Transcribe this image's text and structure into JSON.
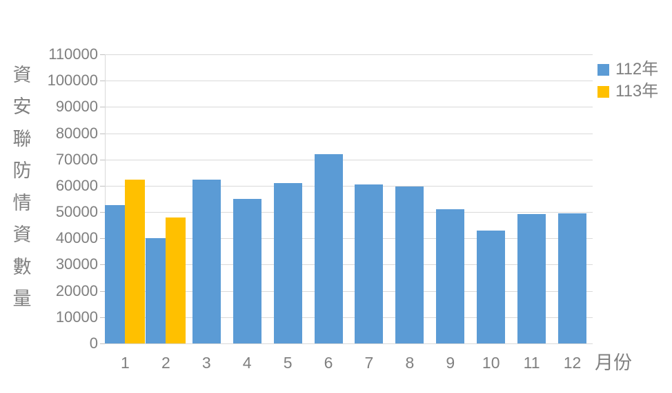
{
  "chart_data": {
    "type": "bar",
    "title": "",
    "subtitle": "",
    "xlabel": "月份",
    "ylabel": "資安聯防情資數量",
    "categories": [
      "1",
      "2",
      "3",
      "4",
      "5",
      "6",
      "7",
      "8",
      "9",
      "10",
      "11",
      "12"
    ],
    "series": [
      {
        "name": "112年",
        "color": "#5B9BD5",
        "values": [
          52600,
          40000,
          62400,
          55000,
          61000,
          72100,
          60400,
          59700,
          51000,
          42900,
          49200,
          49500
        ]
      },
      {
        "name": "113年",
        "color": "#FFC000",
        "values": [
          62400,
          47900,
          null,
          null,
          null,
          null,
          null,
          null,
          null,
          null,
          null,
          null
        ]
      }
    ],
    "ylim": [
      0,
      110000
    ],
    "ytick_values": [
      0,
      10000,
      20000,
      30000,
      40000,
      50000,
      60000,
      70000,
      80000,
      90000,
      100000,
      110000
    ],
    "ytick_labels": [
      "0",
      "10000",
      "20000",
      "30000",
      "40000",
      "50000",
      "60000",
      "70000",
      "80000",
      "90000",
      "100000",
      "110000"
    ],
    "grid": true,
    "grid_axis": "y",
    "legend_position": "top-right",
    "legend_entries": [
      "112年",
      "113年"
    ],
    "axis_label_color": "#7f7f7f",
    "gridline_color": "#d9d9d9",
    "background_color": "#ffffff"
  },
  "y_axis_title_chars": [
    "資",
    "安",
    "聯",
    "防",
    "情",
    "資",
    "數",
    "量"
  ]
}
